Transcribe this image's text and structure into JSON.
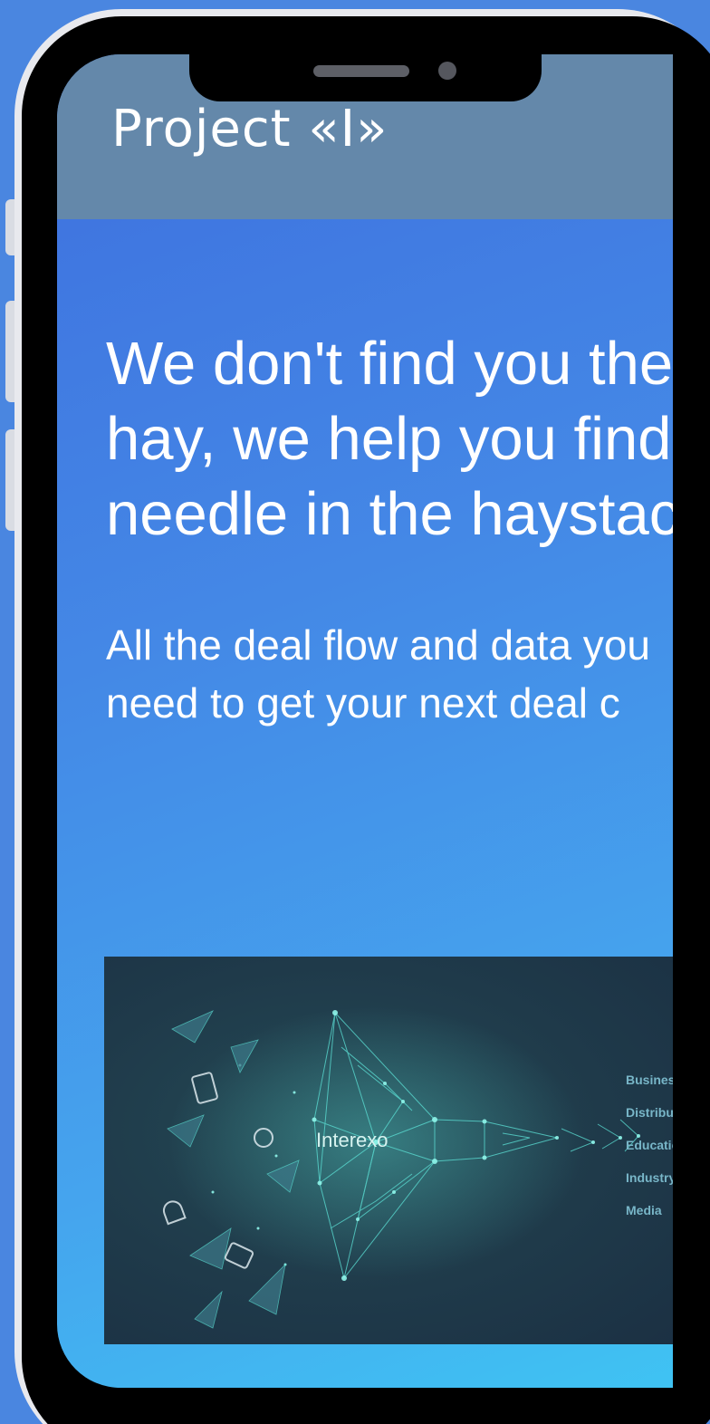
{
  "app": {
    "title": "Project «I»"
  },
  "hero": {
    "headline_lines": [
      "We don't find you the",
      "hay, we help you find",
      "needle in the haystack"
    ],
    "subhead_lines": [
      "All the deal flow and data you",
      "need to get your next deal c"
    ]
  },
  "illustration": {
    "funnel_label": "Interexo",
    "industries": [
      "Business",
      "Distribution",
      "Education",
      "Industry",
      "Media"
    ],
    "colors": {
      "background": "#1f3a4a",
      "mesh": "#5ce1d6"
    }
  },
  "device": {
    "icons": [
      "speaker-icon",
      "front-camera-icon"
    ]
  },
  "colors": {
    "page_background": "#4a86e0",
    "header_background": "#6488aa",
    "text": "#ffffff"
  }
}
